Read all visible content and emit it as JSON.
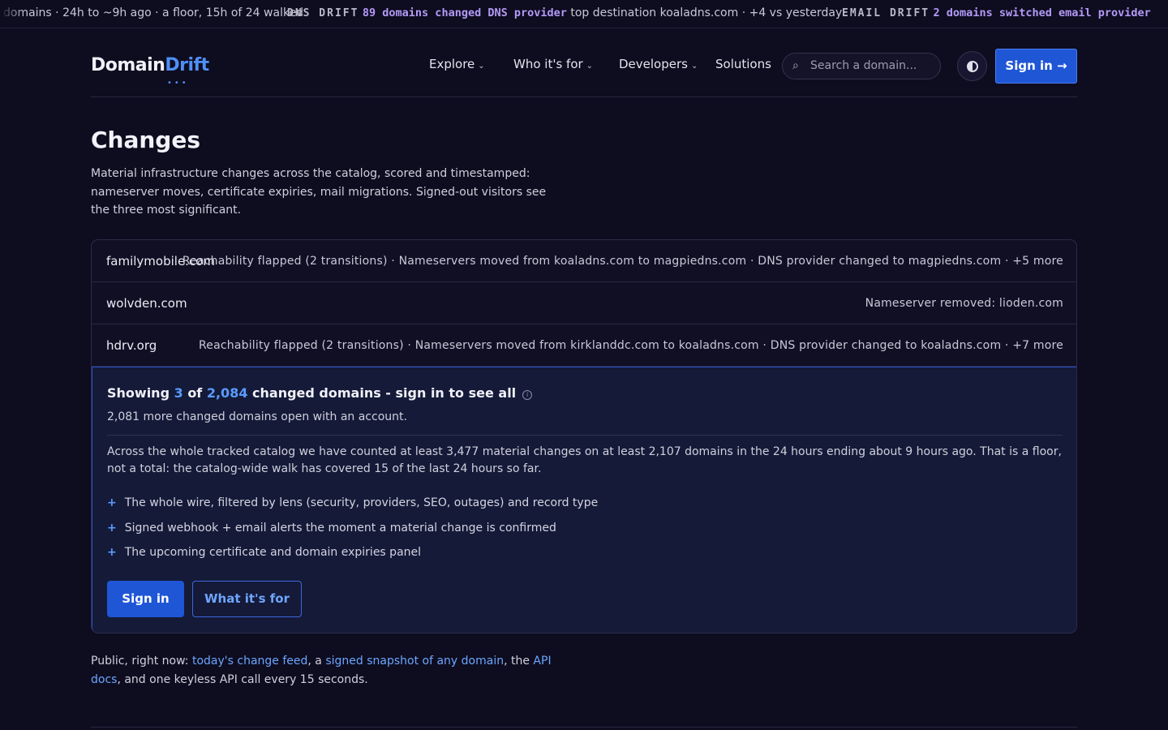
{
  "ticker": {
    "seg1": "domains · 24h to ~9h ago · a floor, 15h of 24 walked",
    "seg2_label": "DNS DRIFT",
    "seg2_highlight": "89 domains changed DNS provider",
    "seg2_text": "top destination koaladns.com · +4 vs yesterday",
    "seg3_label": "EMAIL DRIFT",
    "seg3_highlight": "2 domains switched email provider"
  },
  "nav": {
    "logo_main": "Domain",
    "logo_accent": "Drift",
    "items": [
      {
        "label": "Explore",
        "dropdown": true
      },
      {
        "label": "Who it's for",
        "dropdown": true
      },
      {
        "label": "Developers",
        "dropdown": true
      },
      {
        "label": "Solutions",
        "dropdown": false
      }
    ],
    "search_placeholder": "Search a domain...",
    "signin_label": "Sign in →"
  },
  "page": {
    "title": "Changes",
    "description": "Material infrastructure changes across the catalog, scored and timestamped: nameserver moves, certificate expiries, mail migrations. Signed-out visitors see the three most significant."
  },
  "rows": [
    {
      "domain": "familymobile.com",
      "changes": "Reachability flapped (2 transitions) · Nameservers moved from koaladns.com to magpiedns.com · DNS provider changed to magpiedns.com · +5 more"
    },
    {
      "domain": "wolvden.com",
      "changes": "Nameserver removed: lioden.com"
    },
    {
      "domain": "hdrv.org",
      "changes": "Reachability flapped (2 transitions) · Nameservers moved from kirklanddc.com to koaladns.com · DNS provider changed to koaladns.com · +7 more"
    }
  ],
  "gate": {
    "title_prefix": "Showing",
    "shown": "3",
    "title_of": "of",
    "total": "2,084",
    "title_suffix": "changed domains - sign in to see all",
    "subtitle": "2,081 more changed domains open with an account.",
    "paragraph": "Across the whole tracked catalog we have counted at least 3,477 material changes on at least 2,107 domains in the 24 hours ending about 9 hours ago. That is a floor, not a total: the catalog-wide walk has covered 15 of the last 24 hours so far.",
    "bullets": [
      "The whole wire, filtered by lens (security, providers, SEO, outages) and record type",
      "Signed webhook + email alerts the moment a material change is confirmed",
      "The upcoming certificate and domain expiries panel"
    ],
    "signin_button": "Sign in",
    "what_button": "What it's for"
  },
  "public": {
    "prefix": "Public, right now: ",
    "link1": "today's change feed",
    "sep1": ", a ",
    "link2": "signed snapshot of any domain",
    "sep2": ", the ",
    "link3": "API docs",
    "suffix": ", and one keyless API call every 15 seconds."
  }
}
